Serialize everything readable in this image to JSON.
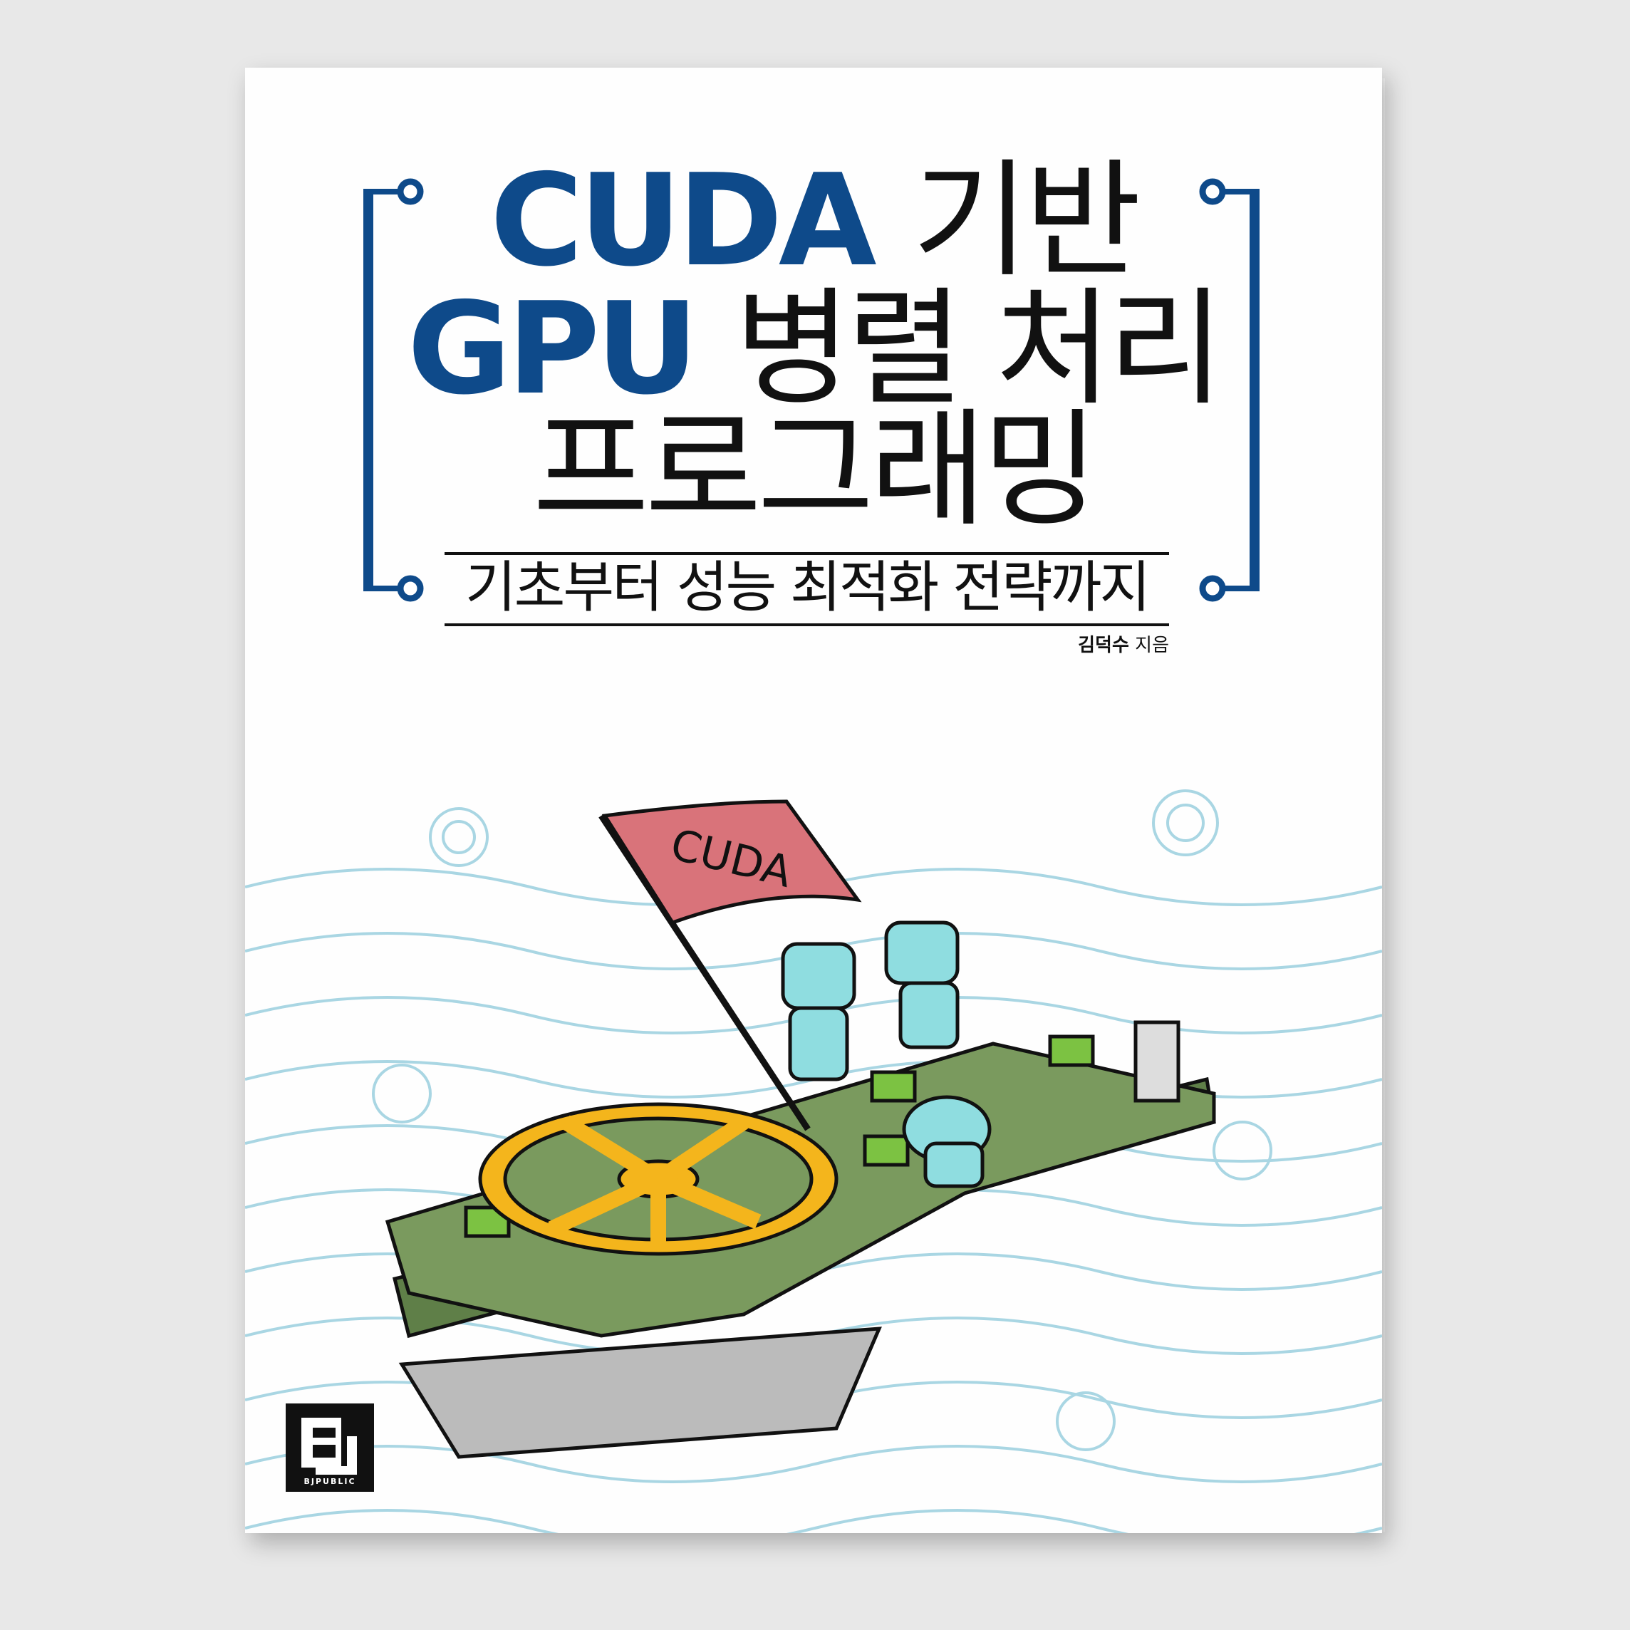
{
  "cover": {
    "title_line1_latin": "CUDA",
    "title_line1_korean": "기반",
    "title_line2_latin": "GPU",
    "title_line2_korean": "병렬 처리",
    "title_line3": "프로그래밍",
    "subtitle": "기초부터 성능 최적화 전략까지",
    "author_name": "김덕수",
    "author_suffix": "지음",
    "flag_text": "CUDA",
    "publisher": "BJPUBLIC"
  },
  "colors": {
    "title_blue": "#0e4a8a",
    "wave": "#a9d6e3",
    "board": "#7a9a5e",
    "fan": "#f4b51c",
    "flag": "#d9737a",
    "robot": "#8fdde0"
  }
}
